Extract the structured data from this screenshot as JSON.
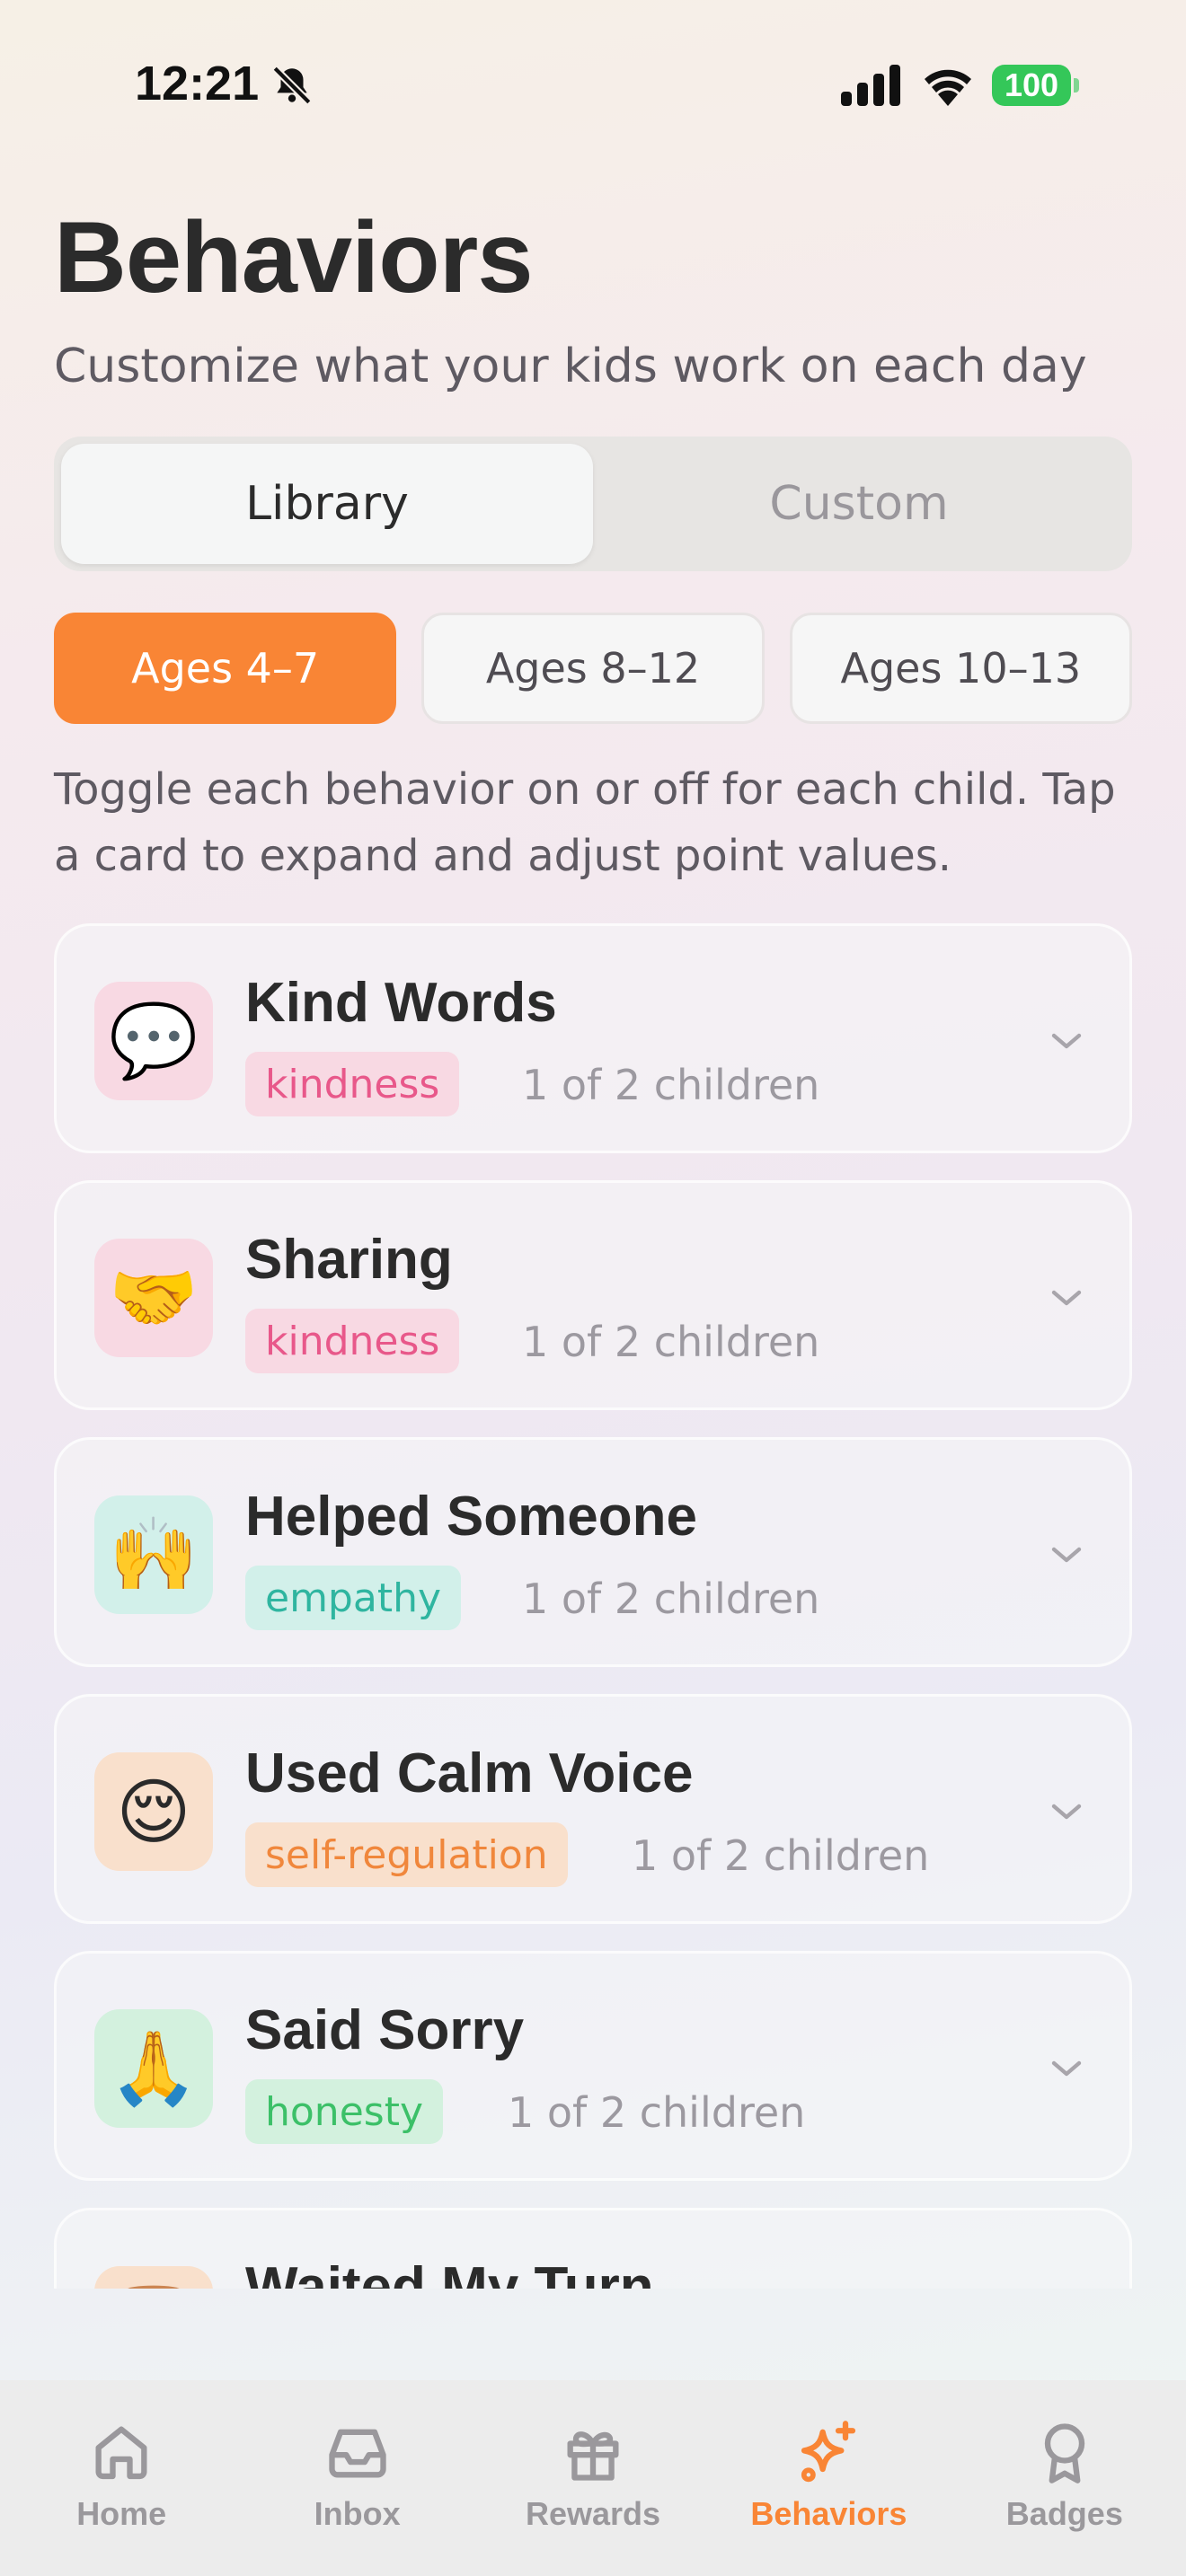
{
  "status_bar": {
    "time": "12:21",
    "battery": "100"
  },
  "header": {
    "title": "Behaviors",
    "subtitle": "Customize what your kids work on each day"
  },
  "segments": [
    {
      "label": "Library",
      "active": true
    },
    {
      "label": "Custom",
      "active": false
    }
  ],
  "age_filters": [
    {
      "label": "Ages 4–7",
      "active": true
    },
    {
      "label": "Ages 8–12",
      "active": false
    },
    {
      "label": "Ages 10–13",
      "active": false
    }
  ],
  "help_text": "Toggle each behavior on or off for each child. Tap a card to expand and adjust point values.",
  "behaviors": [
    {
      "emoji": "💬",
      "title": "Kind Words",
      "tag": "kindness",
      "children": "1 of 2 children",
      "icon": "speech-bubble-icon"
    },
    {
      "emoji": "🤝",
      "title": "Sharing",
      "tag": "kindness",
      "children": "1 of 2 children",
      "icon": "handshake-icon"
    },
    {
      "emoji": "🙌",
      "title": "Helped Someone",
      "tag": "empathy",
      "children": "1 of 2 children",
      "icon": "raised-hands-icon"
    },
    {
      "emoji": "😌",
      "title": "Used Calm Voice",
      "tag": "self-regulation",
      "children": "1 of 2 children",
      "icon": "relieved-face-icon"
    },
    {
      "emoji": "🙏",
      "title": "Said Sorry",
      "tag": "honesty",
      "children": "1 of 2 children",
      "icon": "folded-hands-icon"
    },
    {
      "emoji": "⏳",
      "title": "Waited My Turn",
      "tag": "",
      "children": "",
      "icon": "hourglass-icon"
    }
  ],
  "tag_colors": {
    "kindness": {
      "bg": "#f8d9e3",
      "fg": "#e8588a",
      "icon_bg": "#f8d9e3"
    },
    "empathy": {
      "bg": "#d2f0ea",
      "fg": "#2fb5a0",
      "icon_bg": "#d2f0ea"
    },
    "self-regulation": {
      "bg": "#f9e0cc",
      "fg": "#f0873c",
      "icon_bg": "#f9e0cc"
    },
    "honesty": {
      "bg": "#d3f1de",
      "fg": "#3cc068",
      "icon_bg": "#d3f1de"
    }
  },
  "tabs": [
    {
      "label": "Home",
      "icon": "home-icon",
      "active": false
    },
    {
      "label": "Inbox",
      "icon": "inbox-icon",
      "active": false
    },
    {
      "label": "Rewards",
      "icon": "gift-icon",
      "active": false
    },
    {
      "label": "Behaviors",
      "icon": "sparkles-icon",
      "active": true
    },
    {
      "label": "Badges",
      "icon": "badge-icon",
      "active": false
    }
  ],
  "accent_color": "#f98535"
}
